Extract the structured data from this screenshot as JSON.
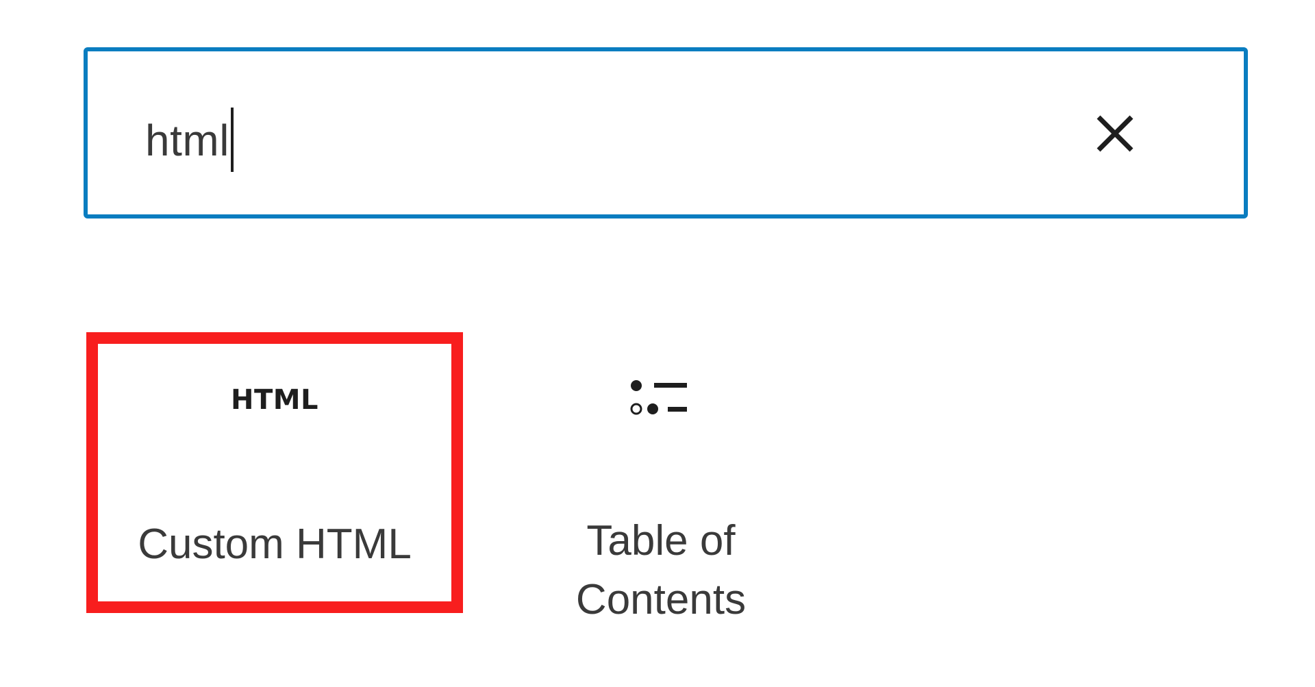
{
  "search": {
    "value": "html",
    "clear_icon": "close-icon"
  },
  "results": [
    {
      "label": "Custom HTML",
      "icon_text": "HTML",
      "icon": "html-block-icon",
      "highlighted": true,
      "highlight_color": "#f81e1e"
    },
    {
      "label": "Table of Contents",
      "icon": "table-of-contents-icon",
      "highlighted": false
    }
  ],
  "colors": {
    "focus_border": "#0a7dc0",
    "text": "#3a3a3a",
    "icon": "#1e1e1e"
  }
}
